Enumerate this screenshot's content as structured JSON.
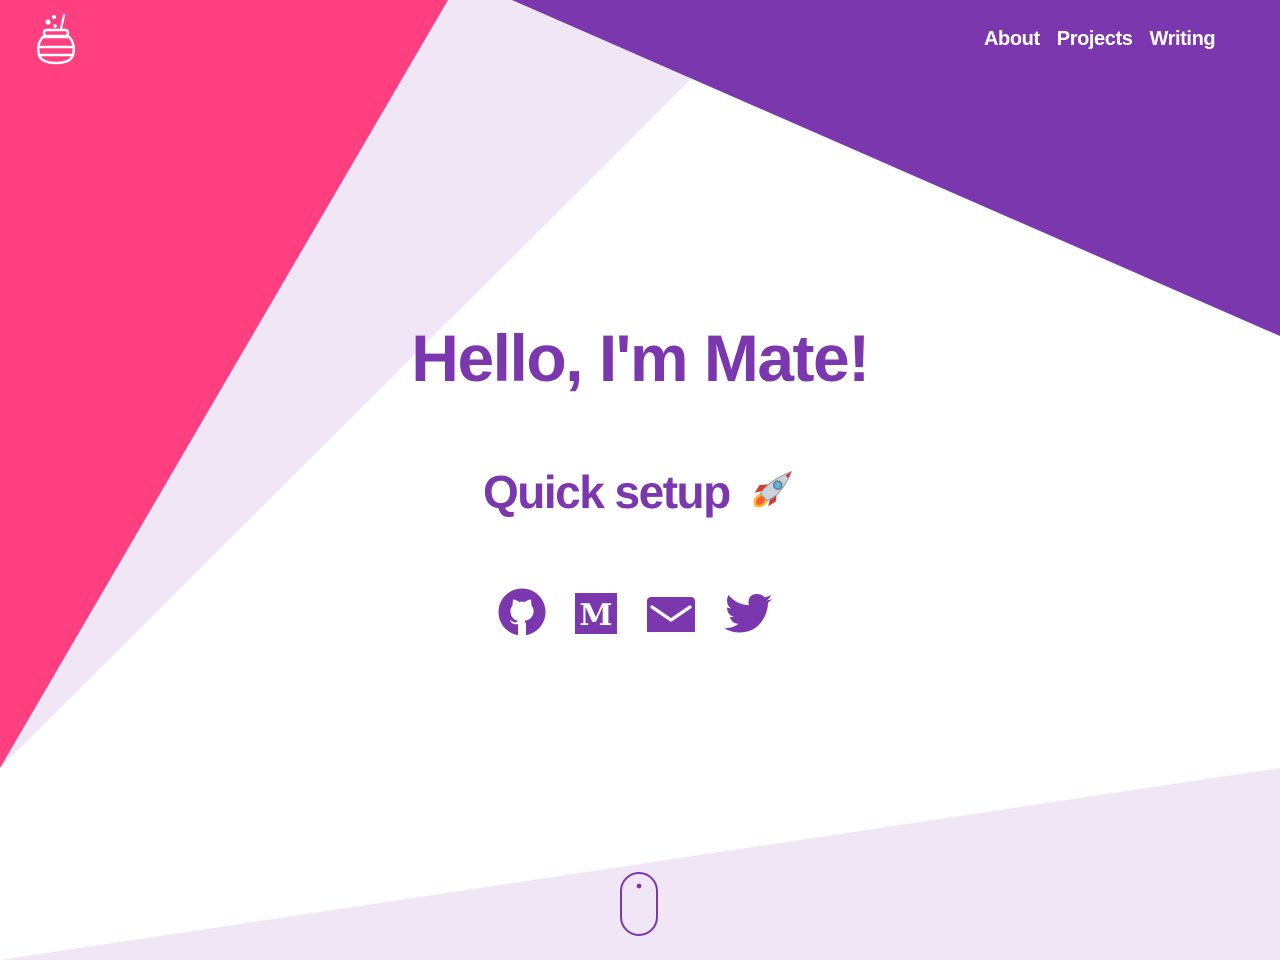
{
  "brand": {
    "logo_icon": "honey-pot-icon",
    "colors": {
      "pink": "#ff3f7f",
      "purple": "#7b37ad",
      "lavender": "#f0e6f5",
      "white": "#ffffff"
    }
  },
  "nav": {
    "items": [
      {
        "label": "About"
      },
      {
        "label": "Projects"
      },
      {
        "label": "Writing"
      }
    ]
  },
  "hero": {
    "title": "Hello, I'm Mate!",
    "subtitle": "Quick setup",
    "subtitle_icon": "rocket-icon"
  },
  "socials": [
    {
      "icon": "github-icon"
    },
    {
      "icon": "medium-icon"
    },
    {
      "icon": "email-icon"
    },
    {
      "icon": "twitter-icon"
    }
  ],
  "scroll_indicator": {
    "icon": "mouse-scroll-icon"
  }
}
